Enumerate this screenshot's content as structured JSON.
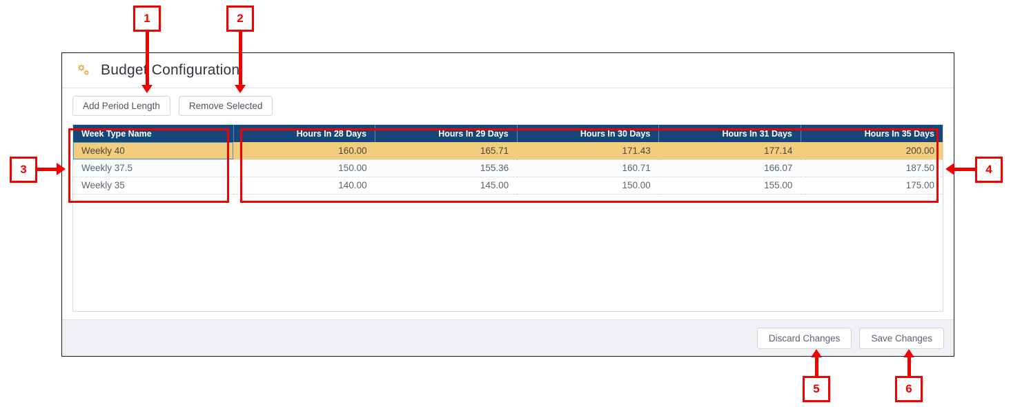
{
  "panel": {
    "title": "Budget Configuration",
    "icon": "cogs-icon"
  },
  "toolbar": {
    "add_period_length_label": "Add Period Length",
    "remove_selected_label": "Remove Selected"
  },
  "grid": {
    "columns": [
      "Week Type Name",
      "Hours In 28 Days",
      "Hours In 29 Days",
      "Hours In 30 Days",
      "Hours In 31 Days",
      "Hours In 35 Days"
    ],
    "rows": [
      {
        "name": "Weekly 40",
        "d28": "160.00",
        "d29": "165.71",
        "d30": "171.43",
        "d31": "177.14",
        "d35": "200.00",
        "selected": true
      },
      {
        "name": "Weekly 37.5",
        "d28": "150.00",
        "d29": "155.36",
        "d30": "160.71",
        "d31": "166.07",
        "d35": "187.50",
        "selected": false
      },
      {
        "name": "Weekly 35",
        "d28": "140.00",
        "d29": "145.00",
        "d30": "150.00",
        "d31": "155.00",
        "d35": "175.00",
        "selected": false
      }
    ]
  },
  "footer": {
    "discard_label": "Discard Changes",
    "save_label": "Save Changes"
  },
  "annotations": [
    {
      "id": "1",
      "label": "1"
    },
    {
      "id": "2",
      "label": "2"
    },
    {
      "id": "3",
      "label": "3"
    },
    {
      "id": "4",
      "label": "4"
    },
    {
      "id": "5",
      "label": "5"
    },
    {
      "id": "6",
      "label": "6"
    }
  ],
  "colors": {
    "header_blue": "#16477a",
    "selected_row": "#f2cd7e",
    "annotation_red": "#f20000",
    "gear_gold": "#e8a93b",
    "footer_bg": "#eff1f5"
  }
}
